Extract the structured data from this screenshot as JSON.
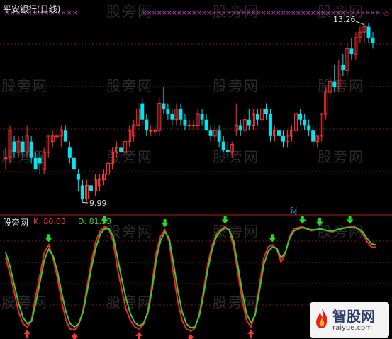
{
  "title": "平安银行(日线)",
  "watermark_text": "股旁网",
  "high_label": "13.26",
  "low_label": "9.99",
  "fin_badge": "财",
  "lower_panel_name": "股旁网",
  "k_label": "K: 80.03",
  "d_label": "D: 81.53",
  "logo": {
    "brand": "智股网",
    "domain": "raiyue.com"
  },
  "colors": {
    "bg": "#000000",
    "up": "#ff3333",
    "down": "#00e5ee",
    "k_line": "#ff2020",
    "d_line": "#33cc33",
    "grid": "#7a1a1a",
    "marker": "#cc33cc"
  },
  "chart_data": [
    {
      "type": "candlestick",
      "title": "平安银行(日线)",
      "xlabel": "",
      "ylabel": "",
      "ylim": [
        9.8,
        13.4
      ],
      "annotations": [
        {
          "label": "13.26",
          "x": 87,
          "y": 13.26
        },
        {
          "label": "9.99",
          "x": 18,
          "y": 9.99
        }
      ],
      "candles": [
        [
          10.8,
          11.0,
          10.6,
          10.8
        ],
        [
          10.8,
          11.4,
          10.7,
          11.3
        ],
        [
          11.1,
          11.2,
          10.8,
          10.9
        ],
        [
          10.9,
          11.2,
          10.8,
          11.1
        ],
        [
          11.1,
          11.2,
          10.8,
          10.9
        ],
        [
          10.9,
          11.4,
          10.8,
          11.2
        ],
        [
          11.1,
          11.2,
          10.7,
          10.8
        ],
        [
          10.8,
          10.9,
          10.6,
          10.6
        ],
        [
          10.8,
          10.9,
          10.5,
          10.7
        ],
        [
          10.6,
          11.0,
          10.5,
          10.9
        ],
        [
          10.9,
          11.2,
          10.8,
          11.2
        ],
        [
          11.1,
          11.3,
          11.0,
          11.2
        ],
        [
          11.2,
          11.3,
          11.1,
          11.2
        ],
        [
          11.2,
          11.4,
          11.0,
          11.3
        ],
        [
          11.3,
          11.4,
          11.1,
          11.1
        ],
        [
          11.0,
          11.1,
          10.7,
          10.8
        ],
        [
          10.8,
          10.9,
          10.6,
          10.6
        ],
        [
          10.5,
          10.6,
          10.2,
          10.4
        ],
        [
          10.3,
          10.4,
          9.99,
          10.05
        ],
        [
          10.05,
          10.4,
          10.0,
          10.3
        ],
        [
          10.3,
          10.4,
          10.1,
          10.2
        ],
        [
          10.2,
          10.5,
          10.1,
          10.4
        ],
        [
          10.3,
          10.5,
          10.2,
          10.4
        ],
        [
          10.4,
          10.6,
          10.3,
          10.5
        ],
        [
          10.5,
          10.8,
          10.4,
          10.7
        ],
        [
          10.7,
          11.0,
          10.6,
          10.9
        ],
        [
          10.9,
          11.1,
          10.8,
          11.0
        ],
        [
          11.0,
          11.1,
          10.8,
          10.9
        ],
        [
          10.9,
          11.2,
          10.8,
          11.1
        ],
        [
          11.1,
          11.4,
          11.0,
          11.3
        ],
        [
          11.2,
          11.5,
          11.1,
          11.4
        ],
        [
          11.4,
          11.8,
          11.3,
          11.7
        ],
        [
          11.8,
          11.9,
          11.4,
          11.5
        ],
        [
          11.5,
          11.6,
          11.2,
          11.3
        ],
        [
          11.3,
          11.4,
          11.2,
          11.3
        ],
        [
          11.3,
          11.4,
          11.2,
          11.3
        ],
        [
          11.3,
          11.9,
          11.2,
          11.8
        ],
        [
          11.8,
          12.1,
          11.6,
          11.7
        ],
        [
          11.7,
          11.8,
          11.5,
          11.6
        ],
        [
          11.6,
          11.7,
          11.4,
          11.5
        ],
        [
          11.5,
          11.8,
          11.4,
          11.7
        ],
        [
          11.7,
          11.8,
          11.4,
          11.5
        ],
        [
          11.5,
          11.6,
          11.3,
          11.4
        ],
        [
          11.4,
          11.5,
          11.3,
          11.4
        ],
        [
          11.4,
          11.5,
          11.3,
          11.4
        ],
        [
          11.4,
          11.7,
          11.3,
          11.6
        ],
        [
          11.6,
          11.7,
          11.4,
          11.5
        ],
        [
          11.5,
          11.6,
          11.3,
          11.3
        ],
        [
          11.3,
          11.4,
          11.1,
          11.2
        ],
        [
          11.2,
          11.4,
          11.1,
          11.3
        ],
        [
          11.3,
          11.4,
          11.0,
          11.1
        ],
        [
          11.1,
          11.2,
          10.9,
          10.95
        ],
        [
          10.95,
          11.1,
          10.8,
          10.9
        ],
        [
          10.9,
          11.1,
          10.8,
          11.05
        ],
        [
          11.3,
          11.8,
          11.2,
          11.4
        ],
        [
          11.4,
          11.5,
          11.2,
          11.3
        ],
        [
          11.3,
          11.6,
          11.2,
          11.5
        ],
        [
          11.5,
          11.7,
          11.3,
          11.4
        ],
        [
          11.4,
          11.7,
          11.3,
          11.6
        ],
        [
          11.6,
          11.7,
          11.4,
          11.5
        ],
        [
          11.5,
          11.8,
          11.4,
          11.7
        ],
        [
          11.7,
          11.8,
          11.5,
          11.6
        ],
        [
          11.6,
          11.7,
          11.1,
          11.2
        ],
        [
          11.2,
          11.4,
          11.1,
          11.3
        ],
        [
          11.3,
          11.4,
          11.1,
          11.2
        ],
        [
          11.2,
          11.3,
          11.0,
          11.1
        ],
        [
          11.1,
          11.3,
          11.0,
          11.2
        ],
        [
          11.2,
          11.4,
          11.1,
          11.3
        ],
        [
          11.3,
          11.7,
          11.2,
          11.6
        ],
        [
          11.6,
          11.7,
          11.4,
          11.5
        ],
        [
          11.5,
          11.6,
          11.3,
          11.4
        ],
        [
          11.4,
          11.5,
          11.2,
          11.3
        ],
        [
          11.3,
          11.4,
          11.0,
          11.1
        ],
        [
          11.1,
          11.2,
          11.0,
          11.2
        ],
        [
          11.2,
          11.6,
          11.1,
          11.6
        ],
        [
          11.6,
          12.1,
          11.5,
          12.0
        ],
        [
          12.0,
          12.3,
          11.9,
          12.2
        ],
        [
          12.2,
          12.5,
          12.0,
          12.1
        ],
        [
          12.1,
          12.6,
          12.0,
          12.5
        ],
        [
          12.5,
          12.7,
          12.3,
          12.4
        ],
        [
          12.4,
          12.9,
          12.3,
          12.8
        ],
        [
          12.8,
          13.0,
          12.6,
          12.7
        ],
        [
          12.7,
          13.1,
          12.6,
          13.0
        ],
        [
          13.0,
          13.2,
          12.9,
          13.1
        ],
        [
          13.1,
          13.26,
          12.9,
          13.2
        ],
        [
          13.2,
          13.26,
          12.9,
          13.0
        ],
        [
          13.0,
          13.1,
          12.8,
          12.9
        ]
      ]
    },
    {
      "type": "line",
      "title": "",
      "xlabel": "",
      "ylabel": "",
      "ylim": [
        0,
        100
      ],
      "series": [
        {
          "name": "K",
          "values": [
            70,
            55,
            38,
            20,
            9,
            6,
            12,
            35,
            55,
            75,
            82,
            70,
            52,
            30,
            12,
            4,
            3,
            8,
            22,
            45,
            68,
            86,
            95,
            99,
            97,
            85,
            60,
            40,
            22,
            12,
            6,
            4,
            8,
            20,
            45,
            75,
            90,
            96,
            85,
            55,
            30,
            12,
            4,
            2,
            5,
            18,
            40,
            65,
            82,
            92,
            96,
            99,
            95,
            80,
            55,
            30,
            12,
            6,
            18,
            45,
            70,
            80,
            82,
            78,
            66,
            74,
            90,
            97,
            98,
            99,
            97,
            95,
            96,
            97,
            96,
            95,
            94,
            96,
            97,
            98,
            99,
            99,
            97,
            92,
            85,
            80,
            80
          ]
        },
        {
          "name": "D",
          "values": [
            75,
            62,
            45,
            28,
            15,
            9,
            11,
            28,
            48,
            68,
            78,
            72,
            58,
            38,
            20,
            9,
            6,
            9,
            20,
            40,
            62,
            80,
            92,
            97,
            97,
            90,
            70,
            50,
            32,
            18,
            10,
            7,
            9,
            18,
            40,
            68,
            86,
            94,
            88,
            65,
            40,
            20,
            9,
            5,
            6,
            16,
            36,
            60,
            78,
            90,
            95,
            98,
            96,
            85,
            62,
            38,
            18,
            10,
            17,
            40,
            64,
            76,
            80,
            79,
            70,
            75,
            88,
            95,
            97,
            98,
            97,
            96,
            96,
            97,
            96,
            95,
            95,
            96,
            97,
            98,
            98,
            98,
            97,
            94,
            88,
            83,
            82
          ]
        }
      ],
      "legend": [
        "K: 80.03",
        "D: 81.53"
      ]
    }
  ]
}
